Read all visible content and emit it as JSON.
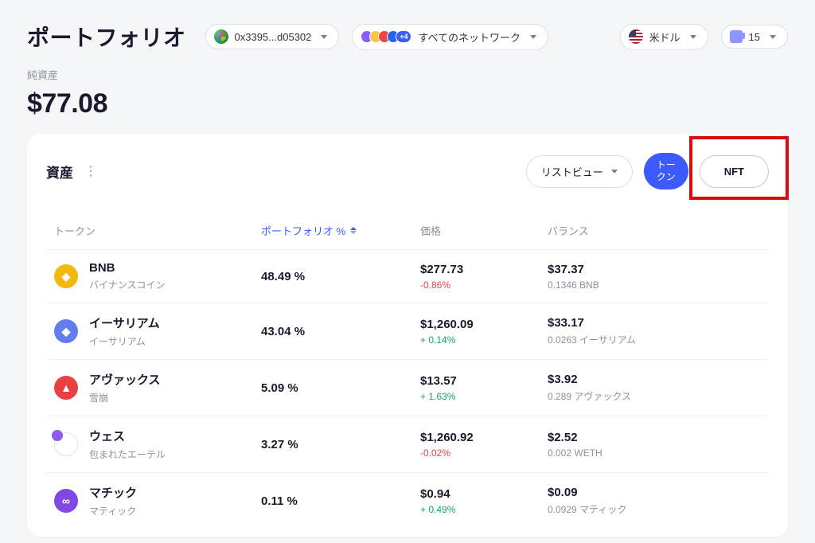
{
  "header": {
    "title": "ポートフォリオ",
    "wallet_address": "0x3395...d05302",
    "network_label": "すべてのネットワーク",
    "network_more_count": "+4",
    "currency_label": "米ドル",
    "gas_value": "15"
  },
  "networth": {
    "label": "純資産",
    "value": "$77.08"
  },
  "assets": {
    "section_title": "資産",
    "listview_label": "リストビュー",
    "tab_token_label": "トークン",
    "tab_nft_label": "NFT",
    "columns": {
      "token": "トークン",
      "portfolio_pct": "ポートフォリオ %",
      "price": "価格",
      "balance": "バランス"
    },
    "rows": [
      {
        "name": "BNB",
        "subtitle": "バイナンスコイン",
        "icon_class": "ico-bnb",
        "glyph": "◈",
        "portfolio_pct": "48.49 %",
        "price": "$277.73",
        "price_change": "-0.86%",
        "price_change_class": "chg-neg",
        "balance": "$37.37",
        "balance_sub": "0.1346 BNB"
      },
      {
        "name": "イーサリアム",
        "subtitle": "イーサリアム",
        "icon_class": "ico-eth",
        "glyph": "◆",
        "portfolio_pct": "43.04 %",
        "price": "$1,260.09",
        "price_change": "+ 0.14%",
        "price_change_class": "chg-pos",
        "balance": "$33.17",
        "balance_sub": "0.0263 イーサリアム"
      },
      {
        "name": "アヴァックス",
        "subtitle": "雪崩",
        "icon_class": "ico-avax",
        "glyph": "▲",
        "portfolio_pct": "5.09 %",
        "price": "$13.57",
        "price_change": "+ 1.63%",
        "price_change_class": "chg-pos",
        "balance": "$3.92",
        "balance_sub": "0.289 アヴァックス"
      },
      {
        "name": "ウェス",
        "subtitle": "包まれたエーテル",
        "icon_class": "ico-weth",
        "glyph": "◆",
        "portfolio_pct": "3.27 %",
        "price": "$1,260.92",
        "price_change": "-0.02%",
        "price_change_class": "chg-neg",
        "balance": "$2.52",
        "balance_sub": "0.002 WETH"
      },
      {
        "name": "マチック",
        "subtitle": "マティック",
        "icon_class": "ico-matic",
        "glyph": "∞",
        "portfolio_pct": "0.11 %",
        "price": "$0.94",
        "price_change": "+ 0.49%",
        "price_change_class": "chg-pos",
        "balance": "$0.09",
        "balance_sub": "0.0929 マティック"
      }
    ]
  }
}
